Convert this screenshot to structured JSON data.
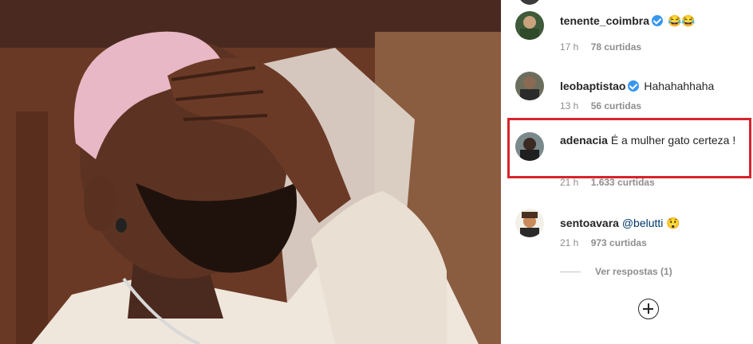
{
  "post": {
    "image_alt": "Foto de um homem com cabelo rosa com a mão na testa"
  },
  "comments": [
    {
      "username": "tenente_coimbra",
      "verified": true,
      "text": "😂😂",
      "time": "17 h",
      "likes": "78 curtidas"
    },
    {
      "username": "leobaptistao",
      "verified": true,
      "text": "Hahahahhaha",
      "time": "13 h",
      "likes": "56 curtidas"
    },
    {
      "username": "adenacia",
      "verified": false,
      "text": "É a mulher gato certeza !",
      "time": "21 h",
      "likes": "1.633 curtidas"
    },
    {
      "username": "sentoavara",
      "verified": false,
      "mention": "@belutti",
      "text": "😲",
      "time": "21 h",
      "likes": "973 curtidas"
    }
  ],
  "replies_label": "Ver respostas (1)",
  "add_icon": "plus-circle-icon",
  "colors": {
    "highlight": "#d8242c",
    "verified": "#3897f0",
    "meta": "#8e8e8e",
    "mention": "#00376b"
  }
}
